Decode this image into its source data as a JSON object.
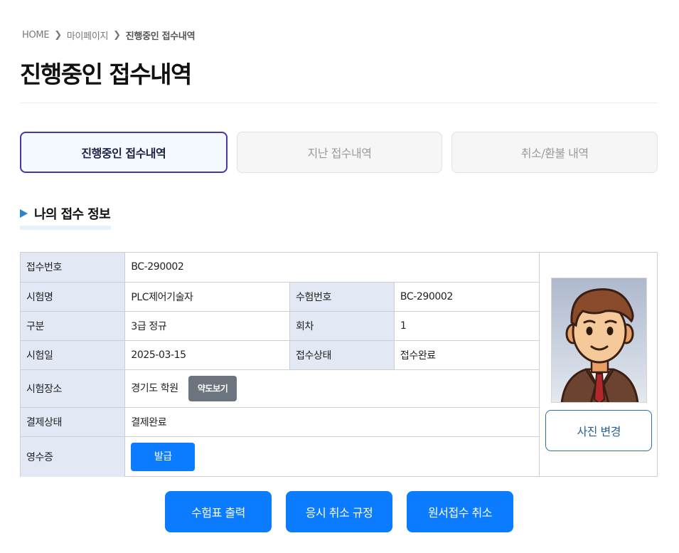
{
  "breadcrumb": {
    "home": "HOME",
    "parent": "마이페이지",
    "current": "진행중인 접수내역"
  },
  "page_title": "진행중인 접수내역",
  "tabs": [
    {
      "label": "진행중인 접수내역",
      "active": true
    },
    {
      "label": "지난 접수내역",
      "active": false
    },
    {
      "label": "취소/환불 내역",
      "active": false
    }
  ],
  "section_title": "나의 접수 정보",
  "info": {
    "receipt_no_label": "접수번호",
    "receipt_no": "BC-290002",
    "exam_name_label": "시험명",
    "exam_name": "PLC제어기술자",
    "exam_no_label": "수험번호",
    "exam_no": "BC-290002",
    "division_label": "구분",
    "division": "3급 정규",
    "round_label": "회차",
    "round": "1",
    "exam_date_label": "시험일",
    "exam_date": "2025-03-15",
    "status_label": "접수상태",
    "status": "접수완료",
    "venue_label": "시험장소",
    "venue": "경기도 학원",
    "map_button": "약도보기",
    "payment_label": "결제상태",
    "payment": "결제완료",
    "receipt_label": "영수증",
    "issue_button": "발급"
  },
  "photo": {
    "change_button": "사진 변경"
  },
  "actions": {
    "print_ticket": "수험표 출력",
    "cancel_policy": "응시 취소 규정",
    "cancel_application": "원서접수 취소"
  },
  "colors": {
    "primary": "#0b7bff",
    "tab_active_border": "#4b34a6",
    "label_bg": "#e3e8f5",
    "section_marker": "#2a86c8"
  }
}
